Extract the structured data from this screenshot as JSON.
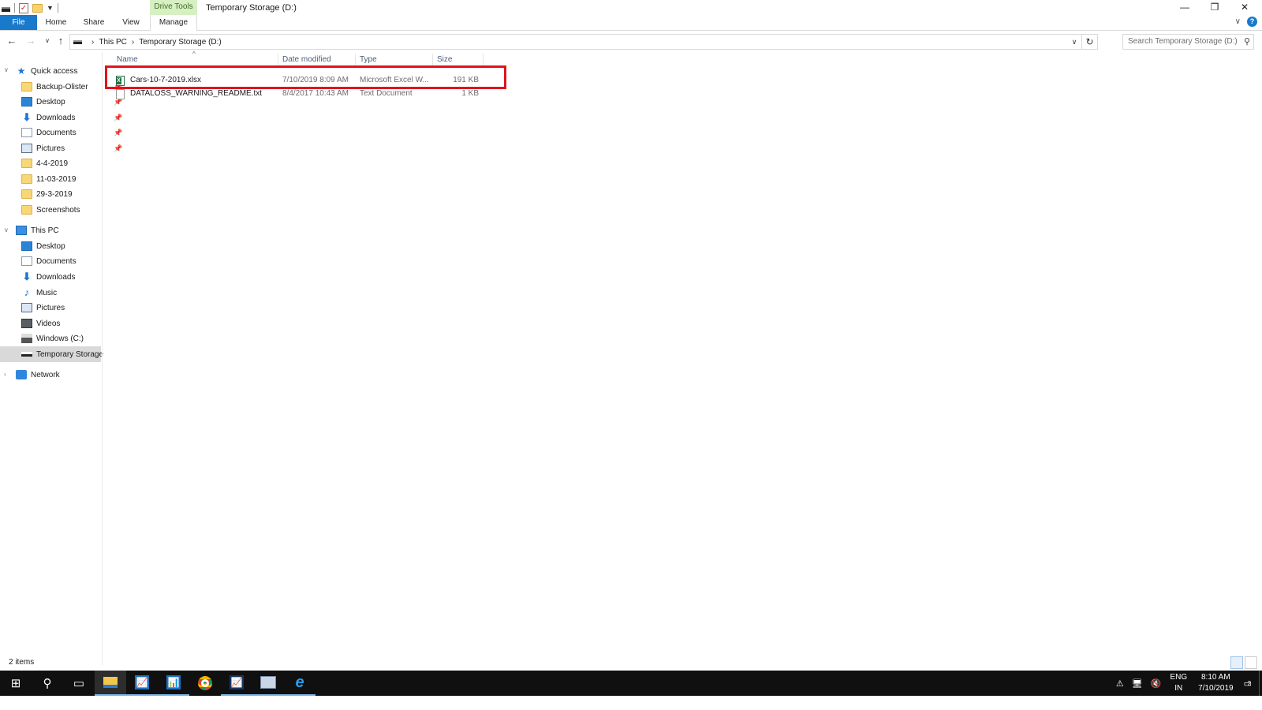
{
  "window": {
    "title": "Temporary Storage (D:)",
    "context_tab_group": "Drive Tools",
    "controls": {
      "minimize": "—",
      "restore": "❐",
      "close": "✕"
    }
  },
  "ribbon": {
    "tabs": [
      "File",
      "Home",
      "Share",
      "View",
      "Manage"
    ],
    "active_context_tab": "Manage",
    "accent_color": "#1979ca"
  },
  "address_bar": {
    "breadcrumb": [
      "This PC",
      "Temporary Storage (D:)"
    ],
    "search_placeholder": "Search Temporary Storage (D:)"
  },
  "sidebar": {
    "quick_access": {
      "label": "Quick access",
      "items": [
        {
          "label": "Backup-Olister",
          "icon": "folder-icon",
          "pinned": true
        },
        {
          "label": "Desktop",
          "icon": "desktop-icon",
          "pinned": true
        },
        {
          "label": "Downloads",
          "icon": "download-icon",
          "pinned": true
        },
        {
          "label": "Documents",
          "icon": "document-icon",
          "pinned": true
        },
        {
          "label": "Pictures",
          "icon": "pictures-icon",
          "pinned": true
        },
        {
          "label": "4-4-2019",
          "icon": "folder-icon",
          "pinned": false
        },
        {
          "label": "11-03-2019",
          "icon": "folder-icon",
          "pinned": false
        },
        {
          "label": "29-3-2019",
          "icon": "folder-icon",
          "pinned": false
        },
        {
          "label": "Screenshots",
          "icon": "folder-icon",
          "pinned": false
        }
      ]
    },
    "this_pc": {
      "label": "This PC",
      "items": [
        {
          "label": "Desktop",
          "icon": "desktop-icon"
        },
        {
          "label": "Documents",
          "icon": "document-icon"
        },
        {
          "label": "Downloads",
          "icon": "download-icon"
        },
        {
          "label": "Music",
          "icon": "music-icon"
        },
        {
          "label": "Pictures",
          "icon": "pictures-icon"
        },
        {
          "label": "Videos",
          "icon": "videos-icon"
        },
        {
          "label": "Windows (C:)",
          "icon": "windows-drive-icon"
        },
        {
          "label": "Temporary Storage",
          "icon": "drive-icon",
          "selected": true
        }
      ]
    },
    "network": {
      "label": "Network"
    }
  },
  "file_list": {
    "columns": [
      "Name",
      "Date modified",
      "Type",
      "Size"
    ],
    "rows": [
      {
        "name": "Cars-10-7-2019.xlsx",
        "date": "7/10/2019 8:09 AM",
        "type": "Microsoft Excel W...",
        "size": "191 KB",
        "icon": "excel-file-icon",
        "highlighted": true
      },
      {
        "name": "DATALOSS_WARNING_README.txt",
        "date": "8/4/2017 10:43 AM",
        "type": "Text Document",
        "size": "1 KB",
        "icon": "text-file-icon",
        "highlighted": false
      }
    ],
    "highlight_color": "#e0141e"
  },
  "status_bar": {
    "item_count": "2 items"
  },
  "taskbar": {
    "apps": [
      "start-icon",
      "search-icon",
      "task-view-icon",
      "file-explorer-icon",
      "chart-app-icon",
      "chart-app-icon",
      "chrome-icon",
      "chart-app-icon",
      "server-manager-icon",
      "internet-explorer-icon"
    ],
    "language": {
      "line1": "ENG",
      "line2": "IN"
    },
    "clock": {
      "time": "8:10 AM",
      "date": "7/10/2019"
    },
    "notification_count": "2"
  }
}
